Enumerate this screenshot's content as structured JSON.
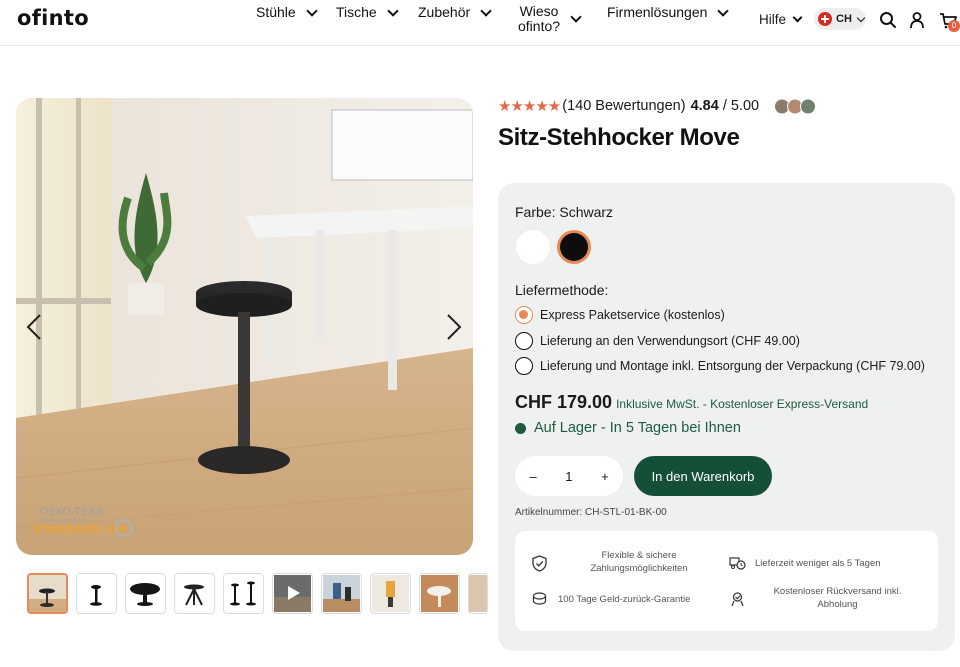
{
  "header": {
    "logo": "ofinto",
    "nav": [
      {
        "label": "Stühle"
      },
      {
        "label": "Tische"
      },
      {
        "label": "Zubehör"
      },
      {
        "label_line1": "Wieso",
        "label_line2": "ofinto?"
      },
      {
        "label": "Firmenlösungen"
      }
    ],
    "help": "Hilfe",
    "country": "CH",
    "cart_count": "0",
    "icons": [
      "search-icon",
      "user-icon",
      "cart-icon"
    ]
  },
  "gallery": {
    "badge_line1": "OEKO-TEX®",
    "badge_line2": "CONFIDENCE IN TEXTILES",
    "badge_line3": "STANDARD 100",
    "thumbnail_count": 10
  },
  "product": {
    "stars": "★★★★★",
    "reviews": "(140 Bewertungen)",
    "score": "4.84",
    "score_max": "/ 5.00",
    "title": "Sitz-Stehhocker Move",
    "color_label": "Farbe: Schwarz",
    "colors": [
      "#ffffff",
      "#0d0d0d"
    ],
    "delivery_label": "Liefermethode:",
    "delivery_options": [
      {
        "label": "Express Paketservice (kostenlos)",
        "checked": true
      },
      {
        "label": "Lieferung an den Verwendungsort (CHF 49.00)",
        "checked": false
      },
      {
        "label": "Lieferung und Montage inkl. Entsorgung der Verpackung (CHF 79.00)",
        "checked": false
      }
    ],
    "price": "CHF 179.00",
    "price_note": "Inklusive MwSt. - Kostenloser Express-Versand",
    "stock": "Auf Lager - In 5 Tagen bei Ihnen",
    "qty_minus": "–",
    "qty_value": "1",
    "qty_plus": "+",
    "add_to_cart": "In den Warenkorb",
    "sku": "Artikelnummer: CH-STL-01-BK-00",
    "features": [
      {
        "text": "Flexible & sichere Zahlungsmöglichkeiten",
        "icon": "shield-check-icon"
      },
      {
        "text": "Lieferzeit weniger als 5 Tagen",
        "icon": "truck-clock-icon"
      },
      {
        "text": "100 Tage Geld-zurück-Garantie",
        "icon": "money-back-icon"
      },
      {
        "text": "Kostenloser Rückversand inkl. Abholung",
        "icon": "return-icon"
      }
    ]
  },
  "colors": {
    "accent": "#e88a55",
    "brand_green": "#154f37",
    "panel_bg": "#eef1ef"
  }
}
